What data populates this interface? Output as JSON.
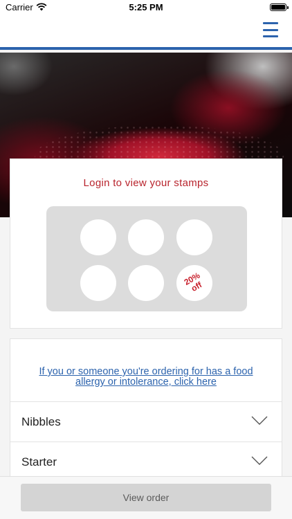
{
  "status_bar": {
    "carrier": "Carrier",
    "time": "5:25 PM"
  },
  "navbar": {
    "menu_icon": "hamburger-menu-icon",
    "accent_color": "#2c63ad"
  },
  "hero": {
    "image_description": "red-wine-splash"
  },
  "stamp_card": {
    "title": "Login to view your stamps",
    "title_color": "#b8232c",
    "stamps_total": 6,
    "stamps_collected": 0,
    "reward_label": "20% off"
  },
  "menu": {
    "allergy_link": "If you or someone you're ordering for has a food allergy or intolerance, click here",
    "sections": [
      {
        "label": "Nibbles",
        "icon": "chevron-down-icon"
      },
      {
        "label": "Starter",
        "icon": "chevron-down-icon"
      }
    ]
  },
  "footer": {
    "view_order_label": "View order"
  }
}
